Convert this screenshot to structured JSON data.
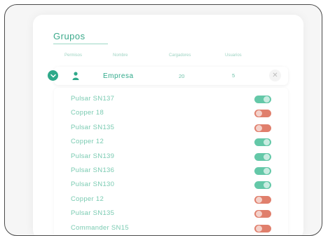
{
  "panel": {
    "title": "Grupos",
    "columns": {
      "permisos": "Permisos",
      "nombre": "Nombre",
      "cargadores": "Cargadores",
      "usuarios": "Usuarios"
    }
  },
  "group": {
    "name": "Empresa",
    "chargers": "20",
    "users": "5",
    "close_symbol": "✕"
  },
  "chargers": [
    {
      "name": "Pulsar SN137",
      "enabled": true
    },
    {
      "name": "Copper 18",
      "enabled": false
    },
    {
      "name": "Pulsar SN135",
      "enabled": false
    },
    {
      "name": "Copper 12",
      "enabled": true
    },
    {
      "name": "Pulsar SN139",
      "enabled": true
    },
    {
      "name": "Pulsar SN136",
      "enabled": true
    },
    {
      "name": "Pulsar SN130",
      "enabled": true
    },
    {
      "name": "Copper 12",
      "enabled": false
    },
    {
      "name": "Pulsar SN135",
      "enabled": false
    },
    {
      "name": "Commander SN15",
      "enabled": false
    }
  ],
  "colors": {
    "accent": "#2fa98a",
    "toggle_on": "#64c8a8",
    "toggle_off": "#e07f6c"
  },
  "icons": {
    "expand": "chevron-down-icon",
    "group": "user-icon",
    "close": "close-icon"
  }
}
